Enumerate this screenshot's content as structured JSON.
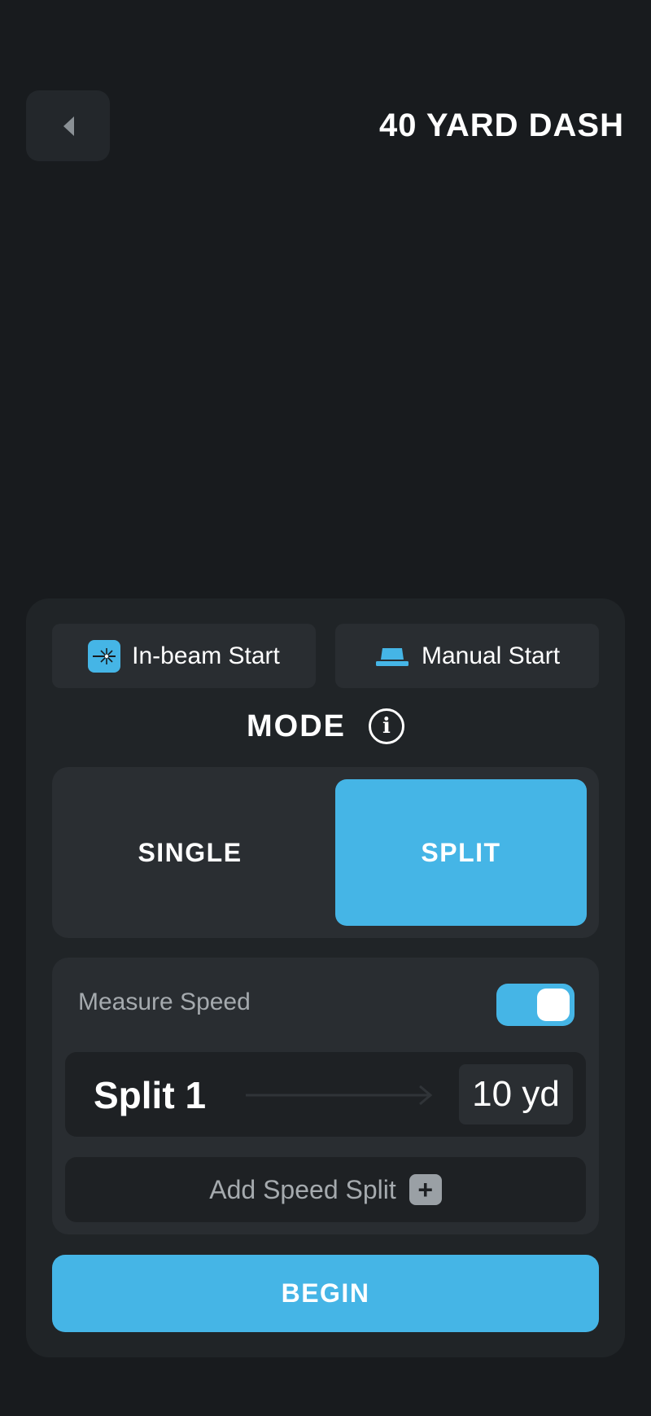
{
  "header": {
    "title": "40 YARD DASH",
    "back_icon": "chevron-left-icon"
  },
  "start_options": {
    "inbeam": {
      "label": "In-beam Start",
      "icon": "laser-beam-icon"
    },
    "manual": {
      "label": "Manual Start",
      "icon": "manual-pad-icon"
    }
  },
  "mode": {
    "label": "MODE",
    "info_icon": "info-icon",
    "info_glyph": "i",
    "options": [
      {
        "label": "SINGLE",
        "selected": false
      },
      {
        "label": "SPLIT",
        "selected": true
      }
    ]
  },
  "splits": {
    "measure_speed_label": "Measure Speed",
    "measure_speed_on": true,
    "items": [
      {
        "name": "Split 1",
        "value": "10 yd"
      }
    ],
    "add_label": "Add Speed Split",
    "add_glyph": "+"
  },
  "actions": {
    "begin_label": "BEGIN"
  },
  "colors": {
    "background": "#181b1e",
    "panel": "#202427",
    "accent": "#45b5e6",
    "muted_text": "#a5aaae"
  }
}
